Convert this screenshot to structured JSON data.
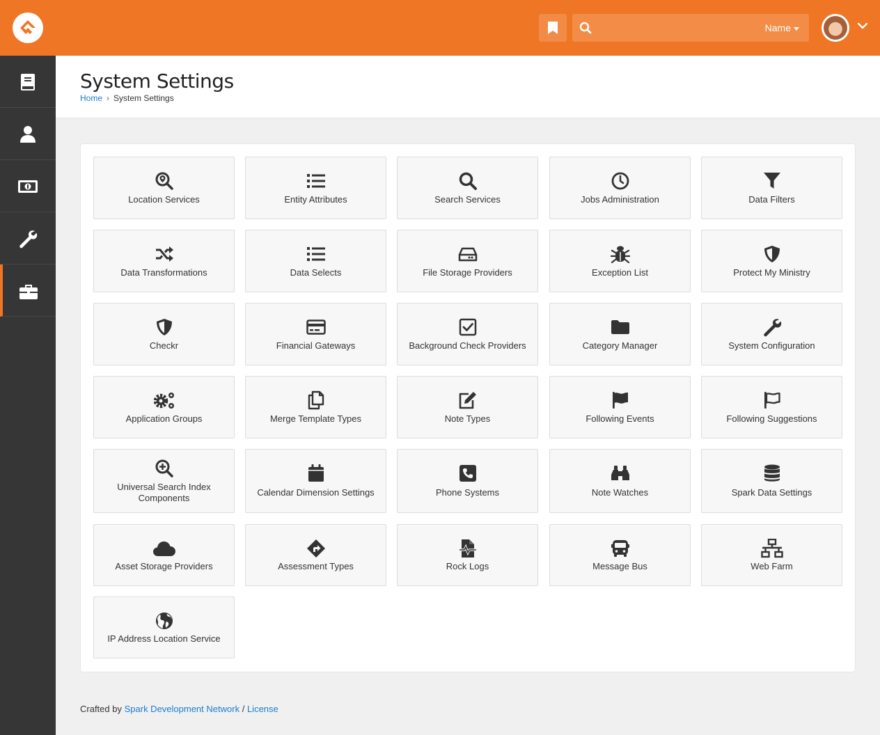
{
  "header": {
    "search_placeholder": "",
    "search_filter_label": "Name",
    "accent_color": "#ee7625"
  },
  "sidebar": {
    "items": [
      {
        "icon": "book-icon",
        "active": false
      },
      {
        "icon": "user-icon",
        "active": false
      },
      {
        "icon": "money-icon",
        "active": false
      },
      {
        "icon": "wrench-icon",
        "active": false
      },
      {
        "icon": "briefcase-icon",
        "active": true
      }
    ]
  },
  "page": {
    "title": "System Settings",
    "breadcrumb": {
      "home": "Home",
      "current": "System Settings"
    }
  },
  "tiles": [
    {
      "label": "Location Services",
      "icon": "search-location-icon"
    },
    {
      "label": "Entity Attributes",
      "icon": "list-icon"
    },
    {
      "label": "Search Services",
      "icon": "search-icon"
    },
    {
      "label": "Jobs Administration",
      "icon": "clock-icon"
    },
    {
      "label": "Data Filters",
      "icon": "filter-icon"
    },
    {
      "label": "Data Transformations",
      "icon": "random-icon"
    },
    {
      "label": "Data Selects",
      "icon": "list-icon"
    },
    {
      "label": "File Storage Providers",
      "icon": "hdd-icon"
    },
    {
      "label": "Exception List",
      "icon": "bug-icon"
    },
    {
      "label": "Protect My Ministry",
      "icon": "shield-icon"
    },
    {
      "label": "Checkr",
      "icon": "shield-icon"
    },
    {
      "label": "Financial Gateways",
      "icon": "credit-card-icon"
    },
    {
      "label": "Background Check Providers",
      "icon": "check-square-icon"
    },
    {
      "label": "Category Manager",
      "icon": "folder-icon"
    },
    {
      "label": "System Configuration",
      "icon": "wrench-icon"
    },
    {
      "label": "Application Groups",
      "icon": "cogs-icon"
    },
    {
      "label": "Merge Template Types",
      "icon": "copy-icon"
    },
    {
      "label": "Note Types",
      "icon": "edit-icon"
    },
    {
      "label": "Following Events",
      "icon": "flag-icon"
    },
    {
      "label": "Following Suggestions",
      "icon": "flag-outline-icon"
    },
    {
      "label": "Universal Search Index Components",
      "icon": "search-plus-icon"
    },
    {
      "label": "Calendar Dimension Settings",
      "icon": "calendar-icon"
    },
    {
      "label": "Phone Systems",
      "icon": "phone-square-icon"
    },
    {
      "label": "Note Watches",
      "icon": "binoculars-icon"
    },
    {
      "label": "Spark Data Settings",
      "icon": "database-icon"
    },
    {
      "label": "Asset Storage Providers",
      "icon": "cloud-icon"
    },
    {
      "label": "Assessment Types",
      "icon": "directions-icon"
    },
    {
      "label": "Rock Logs",
      "icon": "file-medical-alt-icon"
    },
    {
      "label": "Message Bus",
      "icon": "bus-icon"
    },
    {
      "label": "Web Farm",
      "icon": "network-wired-icon"
    },
    {
      "label": "IP Address Location Service",
      "icon": "globe-icon"
    }
  ],
  "footer": {
    "prefix": "Crafted by",
    "link1": "Spark Development Network",
    "separator": "/",
    "link2": "License"
  }
}
